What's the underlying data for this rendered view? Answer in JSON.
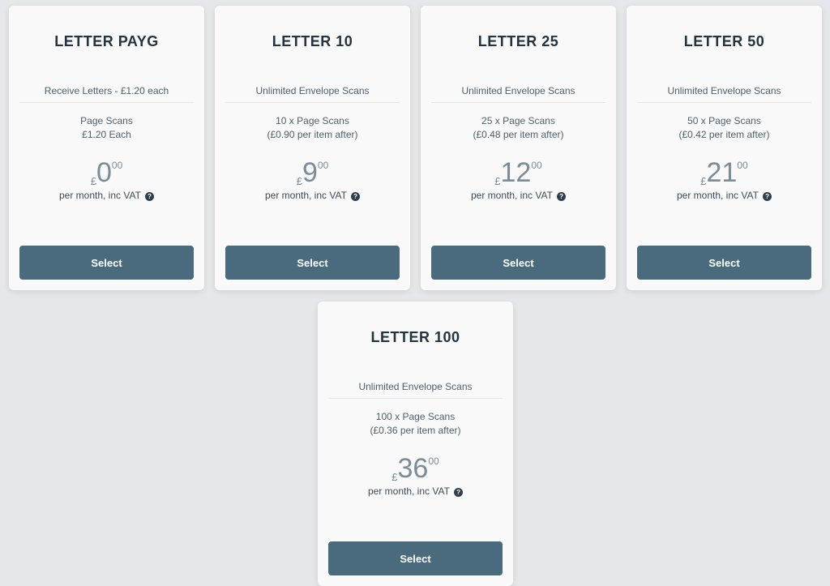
{
  "plans": [
    {
      "title": "LETTER PAYG",
      "line1": "Receive Letters - £1.20 each",
      "scans_line1": "Page Scans",
      "scans_line2": "£1.20 Each",
      "currency": "£",
      "amount": "0",
      "pence": "00",
      "period": "per month, inc VAT",
      "button": "Select"
    },
    {
      "title": "LETTER 10",
      "line1": "Unlimited Envelope Scans",
      "scans_line1": "10 x Page Scans",
      "scans_line2": "(£0.90 per item after)",
      "currency": "£",
      "amount": "9",
      "pence": "00",
      "period": "per month, inc VAT",
      "button": "Select"
    },
    {
      "title": "LETTER 25",
      "line1": "Unlimited Envelope Scans",
      "scans_line1": "25 x Page Scans",
      "scans_line2": "(£0.48 per item after)",
      "currency": "£",
      "amount": "12",
      "pence": "00",
      "period": "per month, inc VAT",
      "button": "Select"
    },
    {
      "title": "LETTER 50",
      "line1": "Unlimited Envelope Scans",
      "scans_line1": "50 x Page Scans",
      "scans_line2": "(£0.42 per item after)",
      "currency": "£",
      "amount": "21",
      "pence": "00",
      "period": "per month, inc VAT",
      "button": "Select"
    },
    {
      "title": "LETTER 100",
      "line1": "Unlimited Envelope Scans",
      "scans_line1": "100 x Page Scans",
      "scans_line2": "(£0.36 per item after)",
      "currency": "£",
      "amount": "36",
      "pence": "00",
      "period": "per month, inc VAT",
      "button": "Select"
    }
  ],
  "help_icon_glyph": "?",
  "colors": {
    "background": "#e6e7ea",
    "card": "#f9f9f9",
    "button": "#4a6b7e",
    "title": "#23333f",
    "price": "#7c8b98"
  }
}
